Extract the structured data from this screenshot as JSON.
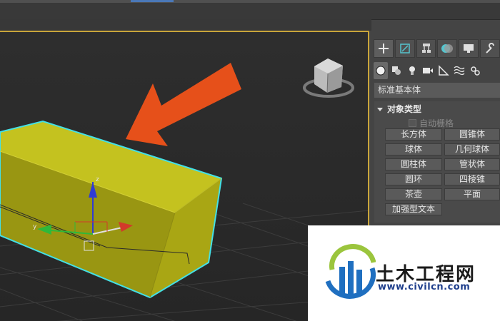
{
  "panel": {
    "category_dropdown": "标准基本体",
    "rollout_title": "对象类型",
    "autogrid_label": "自动栅格",
    "buttons": [
      "长方体",
      "圆锥体",
      "球体",
      "几何球体",
      "圆柱体",
      "管状体",
      "圆环",
      "四棱锥",
      "茶壶",
      "平面",
      "加强型文本"
    ]
  },
  "watermark": {
    "name_cn": "土木工程网",
    "url": "www.civilcn.com"
  },
  "colors": {
    "box_fill": "#b7b51c",
    "box_edge": "#43e0e6",
    "arrow": "#e6501a",
    "viewport_border": "#c9a53a"
  },
  "icons": [
    "create-plus-icon",
    "modify-icon",
    "hierarchy-icon",
    "motion-icon",
    "display-icon",
    "utilities-wrench-icon",
    "geometry-sphere-icon",
    "shapes-icon",
    "lights-icon",
    "cameras-icon",
    "helpers-icon",
    "spacewarps-icon",
    "systems-icon",
    "viewcube-icon",
    "transform-gizmo-icon"
  ]
}
